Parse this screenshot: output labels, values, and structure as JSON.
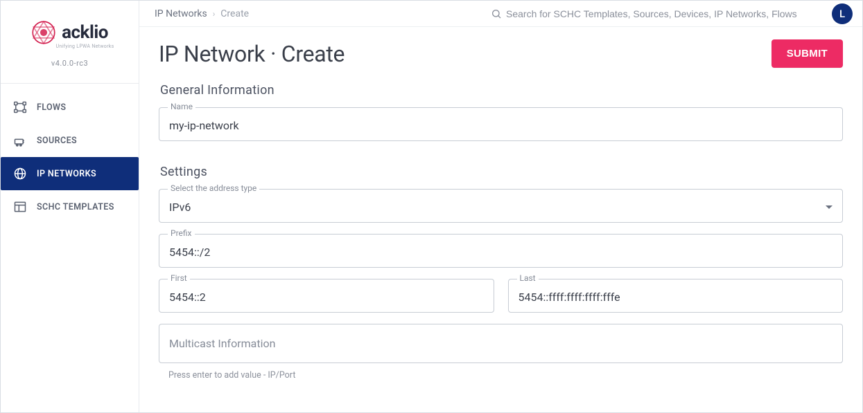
{
  "brand": {
    "name": "acklio",
    "tagline": "Unifying LPWA Networks",
    "version": "v4.0.0-rc3"
  },
  "sidebar": {
    "items": [
      {
        "label": "FLOWS"
      },
      {
        "label": "SOURCES"
      },
      {
        "label": "IP NETWORKS"
      },
      {
        "label": "SCHC TEMPLATES"
      }
    ]
  },
  "topbar": {
    "breadcrumb_link": "IP Networks",
    "breadcrumb_current": "Create",
    "search_placeholder": "Search for SCHC Templates, Sources, Devices, IP Networks, Flows",
    "avatar_initial": "L"
  },
  "page": {
    "title": "IP Network · Create",
    "submit_label": "SUBMIT"
  },
  "sections": {
    "general_title": "General Information",
    "settings_title": "Settings"
  },
  "form": {
    "name": {
      "label": "Name",
      "value": "my-ip-network"
    },
    "address_type": {
      "label": "Select the address type",
      "value": "IPv6"
    },
    "prefix": {
      "label": "Prefix",
      "value": "5454::/2"
    },
    "first": {
      "label": "First",
      "value": "5454::2"
    },
    "last": {
      "label": "Last",
      "value": "5454::ffff:ffff:ffff:fffe"
    },
    "multicast": {
      "placeholder": "Multicast Information",
      "helper": "Press enter to add value - IP/Port"
    }
  }
}
